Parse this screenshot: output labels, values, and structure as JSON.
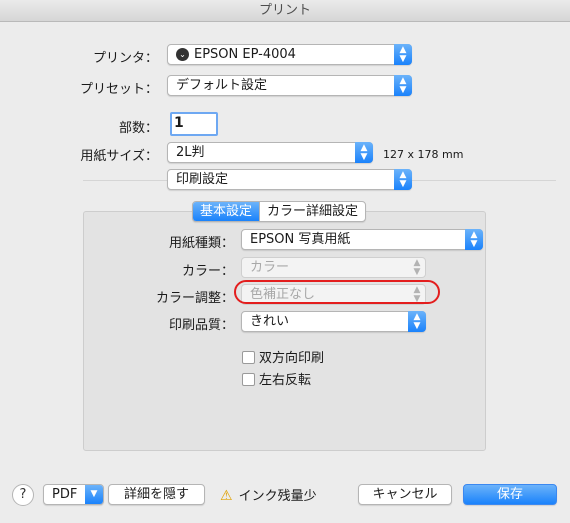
{
  "window": {
    "title": "プリント"
  },
  "printer": {
    "label": "プリンタ：",
    "value": "EPSON EP-4004"
  },
  "preset": {
    "label": "プリセット：",
    "value": "デフォルト設定"
  },
  "copies": {
    "label": "部数：",
    "value": "1"
  },
  "paper_size": {
    "label": "用紙サイズ：",
    "value": "2L判",
    "dimensions": "127 x 178 mm"
  },
  "section_popup": {
    "value": "印刷設定"
  },
  "tabs": [
    {
      "label": "基本設定",
      "selected": true
    },
    {
      "label": "カラー詳細設定",
      "selected": false
    }
  ],
  "settings": {
    "paper_type": {
      "label": "用紙種類：",
      "value": "EPSON 写真用紙"
    },
    "color": {
      "label": "カラー：",
      "value": "カラー",
      "disabled": true
    },
    "color_adjust": {
      "label": "カラー調整：",
      "value": "色補正なし",
      "disabled": true
    },
    "quality": {
      "label": "印刷品質：",
      "value": "きれい"
    },
    "bidirectional": {
      "label": "双方向印刷",
      "checked": false
    },
    "mirror": {
      "label": "左右反転",
      "checked": false
    }
  },
  "footer": {
    "help": "?",
    "pdf": "PDF",
    "hide_details": "詳細を隠す",
    "ink_warning": "インク残量少",
    "cancel": "キャンセル",
    "save": "保存"
  },
  "colors": {
    "accent": "#1a82fb",
    "annotation": "#e31d1d",
    "warning": "#e0a100"
  }
}
